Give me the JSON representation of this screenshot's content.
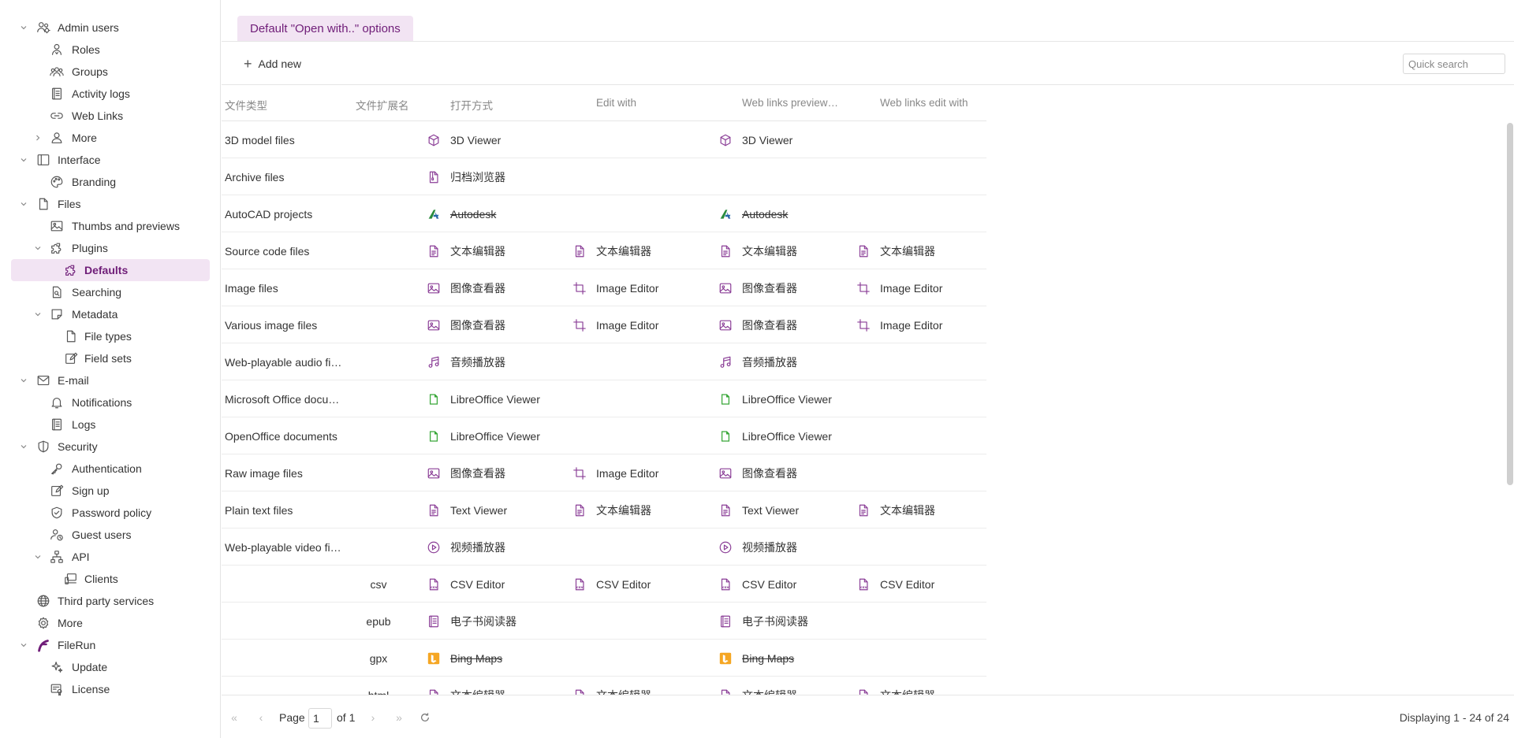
{
  "sidebar": {
    "items": [
      {
        "label": "Admin users",
        "icon": "users-gear-icon",
        "depth": 0,
        "expanded": true,
        "selected": false
      },
      {
        "label": "Roles",
        "icon": "user-badge-icon",
        "depth": 1,
        "selected": false
      },
      {
        "label": "Groups",
        "icon": "group-icon",
        "depth": 1,
        "selected": false
      },
      {
        "label": "Activity logs",
        "icon": "log-book-icon",
        "depth": 1,
        "selected": false
      },
      {
        "label": "Web Links",
        "icon": "link-icon",
        "depth": 1,
        "selected": false
      },
      {
        "label": "More",
        "icon": "user-icon",
        "depth": 1,
        "collapsed": true,
        "selected": false
      },
      {
        "label": "Interface",
        "icon": "layout-icon",
        "depth": 0,
        "expanded": true,
        "selected": false
      },
      {
        "label": "Branding",
        "icon": "palette-icon",
        "depth": 1,
        "selected": false
      },
      {
        "label": "Files",
        "icon": "file-icon",
        "depth": 0,
        "expanded": true,
        "selected": false
      },
      {
        "label": "Thumbs and previews",
        "icon": "image-icon",
        "depth": 1,
        "selected": false
      },
      {
        "label": "Plugins",
        "icon": "puzzle-icon",
        "depth": 1,
        "expanded": true,
        "selected": false
      },
      {
        "label": "Defaults",
        "icon": "puzzle-icon",
        "depth": 2,
        "selected": true
      },
      {
        "label": "Searching",
        "icon": "file-search-icon",
        "depth": 1,
        "selected": false
      },
      {
        "label": "Metadata",
        "icon": "note-icon",
        "depth": 1,
        "expanded": true,
        "selected": false
      },
      {
        "label": "File types",
        "icon": "file-icon",
        "depth": 2,
        "selected": false
      },
      {
        "label": "Field sets",
        "icon": "edit-icon",
        "depth": 2,
        "selected": false
      },
      {
        "label": "E-mail",
        "icon": "mail-icon",
        "depth": 0,
        "expanded": true,
        "selected": false
      },
      {
        "label": "Notifications",
        "icon": "bell-icon",
        "depth": 1,
        "selected": false
      },
      {
        "label": "Logs",
        "icon": "log-book-icon",
        "depth": 1,
        "selected": false
      },
      {
        "label": "Security",
        "icon": "shield-icon",
        "depth": 0,
        "expanded": true,
        "selected": false
      },
      {
        "label": "Authentication",
        "icon": "key-icon",
        "depth": 1,
        "selected": false
      },
      {
        "label": "Sign up",
        "icon": "edit-icon",
        "depth": 1,
        "selected": false
      },
      {
        "label": "Password policy",
        "icon": "shield-check-icon",
        "depth": 1,
        "selected": false
      },
      {
        "label": "Guest users",
        "icon": "user-clock-icon",
        "depth": 1,
        "selected": false
      },
      {
        "label": "API",
        "icon": "network-icon",
        "depth": 1,
        "expanded": true,
        "selected": false
      },
      {
        "label": "Clients",
        "icon": "devices-icon",
        "depth": 2,
        "selected": false
      },
      {
        "label": "Third party services",
        "icon": "globe-icon",
        "depth": 0,
        "selected": false
      },
      {
        "label": "More",
        "icon": "gear-icon",
        "depth": 0,
        "selected": false
      },
      {
        "label": "FileRun",
        "icon": "filerun-logo-icon",
        "depth": 0,
        "expanded": true,
        "selected": false
      },
      {
        "label": "Update",
        "icon": "sparkle-icon",
        "depth": 1,
        "selected": false
      },
      {
        "label": "License",
        "icon": "certificate-icon",
        "depth": 1,
        "selected": false
      }
    ]
  },
  "tabs": {
    "main_label": "Default \"Open with..\" options"
  },
  "toolbar": {
    "add_new_label": "Add new",
    "search_placeholder": "Quick search"
  },
  "grid": {
    "columns": {
      "type": "文件类型",
      "ext": "文件扩展名",
      "open_with": "打开方式",
      "edit_with": "Edit with",
      "web_preview": "Web links preview…",
      "web_edit": "Web links edit with"
    },
    "rows": [
      {
        "type": "3D model files",
        "ext": "",
        "c1": {
          "text": "3D Viewer",
          "icon": "cube-icon"
        },
        "c2": null,
        "c3": {
          "text": "3D Viewer",
          "icon": "cube-icon"
        },
        "c4": null
      },
      {
        "type": "Archive files",
        "ext": "",
        "c1": {
          "text": "归档浏览器",
          "icon": "archive-file-icon"
        },
        "c2": null,
        "c3": null,
        "c4": null
      },
      {
        "type": "AutoCAD projects",
        "ext": "",
        "c1": {
          "text": "Autodesk",
          "icon": "autodesk-icon",
          "strike": true
        },
        "c2": null,
        "c3": {
          "text": "Autodesk",
          "icon": "autodesk-icon",
          "strike": true
        },
        "c4": null
      },
      {
        "type": "Source code files",
        "ext": "",
        "c1": {
          "text": "文本编辑器",
          "icon": "document-icon"
        },
        "c2": {
          "text": "文本编辑器",
          "icon": "document-icon"
        },
        "c3": {
          "text": "文本编辑器",
          "icon": "document-icon"
        },
        "c4": {
          "text": "文本编辑器",
          "icon": "document-icon"
        }
      },
      {
        "type": "Image files",
        "ext": "",
        "c1": {
          "text": "图像查看器",
          "icon": "picture-icon"
        },
        "c2": {
          "text": "Image Editor",
          "icon": "crop-icon"
        },
        "c3": {
          "text": "图像查看器",
          "icon": "picture-icon"
        },
        "c4": {
          "text": "Image Editor",
          "icon": "crop-icon"
        }
      },
      {
        "type": "Various image files",
        "ext": "",
        "c1": {
          "text": "图像查看器",
          "icon": "picture-icon"
        },
        "c2": {
          "text": "Image Editor",
          "icon": "crop-icon"
        },
        "c3": {
          "text": "图像查看器",
          "icon": "picture-icon"
        },
        "c4": {
          "text": "Image Editor",
          "icon": "crop-icon"
        }
      },
      {
        "type": "Web-playable audio fi…",
        "ext": "",
        "c1": {
          "text": "音频播放器",
          "icon": "music-icon"
        },
        "c2": null,
        "c3": {
          "text": "音频播放器",
          "icon": "music-icon"
        },
        "c4": null
      },
      {
        "type": "Microsoft Office docu…",
        "ext": "",
        "c1": {
          "text": "LibreOffice Viewer",
          "icon": "libreoffice-icon"
        },
        "c2": null,
        "c3": {
          "text": "LibreOffice Viewer",
          "icon": "libreoffice-icon"
        },
        "c4": null
      },
      {
        "type": "OpenOffice documents",
        "ext": "",
        "c1": {
          "text": "LibreOffice Viewer",
          "icon": "libreoffice-icon"
        },
        "c2": null,
        "c3": {
          "text": "LibreOffice Viewer",
          "icon": "libreoffice-icon"
        },
        "c4": null
      },
      {
        "type": "Raw image files",
        "ext": "",
        "c1": {
          "text": "图像查看器",
          "icon": "picture-icon"
        },
        "c2": {
          "text": "Image Editor",
          "icon": "crop-icon"
        },
        "c3": {
          "text": "图像查看器",
          "icon": "picture-icon"
        },
        "c4": null
      },
      {
        "type": "Plain text files",
        "ext": "",
        "c1": {
          "text": "Text Viewer",
          "icon": "document-icon"
        },
        "c2": {
          "text": "文本编辑器",
          "icon": "document-icon"
        },
        "c3": {
          "text": "Text Viewer",
          "icon": "document-icon"
        },
        "c4": {
          "text": "文本编辑器",
          "icon": "document-icon"
        }
      },
      {
        "type": "Web-playable video fi…",
        "ext": "",
        "c1": {
          "text": "视频播放器",
          "icon": "play-circle-icon"
        },
        "c2": null,
        "c3": {
          "text": "视频播放器",
          "icon": "play-circle-icon"
        },
        "c4": null
      },
      {
        "type": "",
        "ext": "csv",
        "c1": {
          "text": "CSV Editor",
          "icon": "csv-file-icon"
        },
        "c2": {
          "text": "CSV Editor",
          "icon": "csv-file-icon"
        },
        "c3": {
          "text": "CSV Editor",
          "icon": "csv-file-icon"
        },
        "c4": {
          "text": "CSV Editor",
          "icon": "csv-file-icon"
        }
      },
      {
        "type": "",
        "ext": "epub",
        "c1": {
          "text": "电子书阅读器",
          "icon": "book-icon"
        },
        "c2": null,
        "c3": {
          "text": "电子书阅读器",
          "icon": "book-icon"
        },
        "c4": null
      },
      {
        "type": "",
        "ext": "gpx",
        "c1": {
          "text": "Bing Maps",
          "icon": "bing-icon",
          "strike": true
        },
        "c2": null,
        "c3": {
          "text": "Bing Maps",
          "icon": "bing-icon",
          "strike": true
        },
        "c4": null
      },
      {
        "type": "",
        "ext": "html",
        "c1": {
          "text": "文本编辑器",
          "icon": "document-icon",
          "strike": true
        },
        "c2": {
          "text": "文本编辑器",
          "icon": "document-icon",
          "strike": true
        },
        "c3": {
          "text": "文本编辑器",
          "icon": "document-icon",
          "strike": true
        },
        "c4": {
          "text": "文本编辑器",
          "icon": "document-icon",
          "strike": true
        }
      }
    ]
  },
  "pager": {
    "page_label": "Page",
    "page_value": "1",
    "of_label": "of 1",
    "displaying": "Displaying 1 - 24 of 24"
  },
  "colors": {
    "accent": "#6f1d78",
    "accent_bg": "#f2e4f3",
    "icon_purple": "#8a3d96",
    "green": "#3aa83a",
    "orange": "#f5a623"
  }
}
